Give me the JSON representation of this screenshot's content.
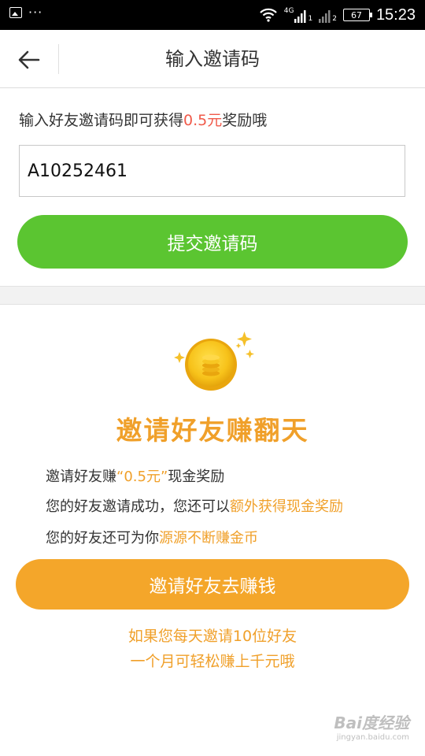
{
  "status_bar": {
    "dots": "···",
    "signal_label": "4G",
    "signal_sub1": "1",
    "signal_sub2": "2",
    "battery": "67",
    "time": "15:23"
  },
  "nav": {
    "title": "输入邀请码"
  },
  "invite": {
    "hint_prefix": "输入好友邀请码即可获得",
    "hint_amount": "0.5元",
    "hint_suffix": "奖励哦",
    "code_value": "A10252461",
    "submit_label": "提交邀请码"
  },
  "promo": {
    "title": "邀请好友赚翻天",
    "line1_prefix": "邀请好友赚",
    "line1_highlight": "“0.5元”",
    "line1_suffix": "现金奖励",
    "line2_prefix": "您的好友邀请成功，您还可以",
    "line2_highlight": "额外获得现金奖励",
    "line3_prefix": "您的好友还可为你",
    "line3_highlight": "源源不断赚金币",
    "button_label": "邀请好友去赚钱",
    "footer_line1": "如果您每天邀请10位好友",
    "footer_line2": "一个月可轻松赚上千元哦"
  },
  "watermark": {
    "main": "Bai度经验",
    "sub": "jingyan.baidu.com"
  },
  "colors": {
    "green": "#5bc531",
    "orange": "#f4a62a",
    "highlight_orange": "#f0a02a",
    "red": "#f05a4a"
  }
}
